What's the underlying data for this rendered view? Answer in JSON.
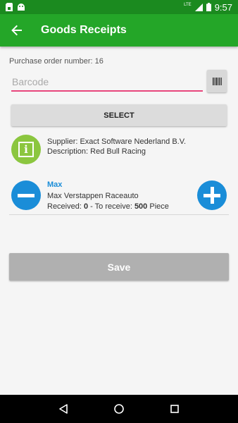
{
  "status_bar": {
    "time": "9:57",
    "network": "LTE",
    "left_icons": [
      "sim-card-icon",
      "android-icon"
    ],
    "right_icons": [
      "signal-icon",
      "battery-icon"
    ]
  },
  "app_bar": {
    "title": "Goods Receipts",
    "back_icon": "arrow-left-icon",
    "color": "#24a628"
  },
  "purchase_order": {
    "label": "Purchase order number: 16"
  },
  "barcode": {
    "placeholder": "Barcode",
    "value": "",
    "scan_icon": "barcode-icon",
    "underline_color": "#e8467c"
  },
  "select_button": {
    "label": "SELECT"
  },
  "order_info": {
    "icon": "info-icon",
    "supplier": "Supplier: Exact Software Nederland B.V.",
    "description": "Description: Red Bull Racing"
  },
  "line_item": {
    "code": "Max",
    "description": "Max Verstappen Raceauto",
    "received_label": "Received: ",
    "received_value": "0",
    "to_receive_label": " - To receive: ",
    "to_receive_value": "500",
    "unit": " Piece",
    "accent_color": "#1a8dd8"
  },
  "save_button": {
    "label": "Save"
  },
  "nav_bar": {
    "icons": [
      "back-triangle-icon",
      "home-circle-icon",
      "recents-square-icon"
    ]
  }
}
